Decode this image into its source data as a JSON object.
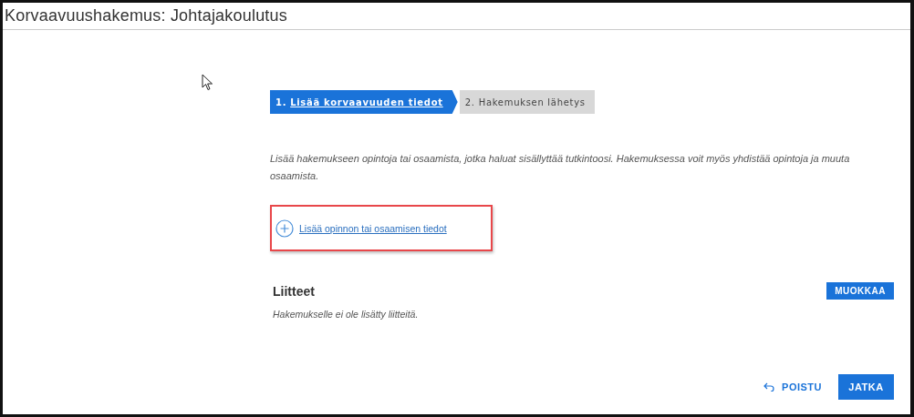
{
  "page": {
    "title": "Korvaavuushakemus: Johtajakoulutus"
  },
  "steps": [
    {
      "number": "1.",
      "label": "Lisää korvaavuuden tiedot",
      "selected": true
    },
    {
      "number": "2.",
      "label": "Hakemuksen lähetys",
      "selected": false
    }
  ],
  "intro": "Lisää hakemukseen opintoja tai osaamista, jotka haluat sisällyttää tutkintoosi. Hakemuksessa voit myös yhdistää opintoja ja muuta osaamista.",
  "add_link": {
    "label": "Lisää opinnon tai osaamisen tiedot",
    "highlighted": true
  },
  "attachments": {
    "heading": "Liitteet",
    "edit_button": "MUOKKAA",
    "empty_text": "Hakemukselle ei ole lisätty liitteitä."
  },
  "footer": {
    "cancel": "POISTU",
    "continue": "JATKA"
  }
}
